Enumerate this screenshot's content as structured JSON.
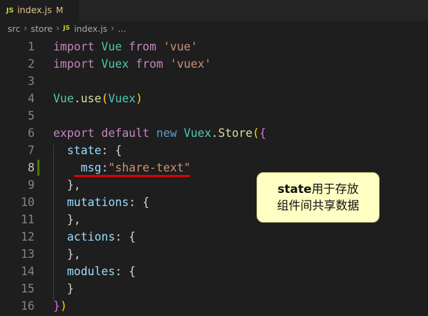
{
  "tab": {
    "icon": "JS",
    "filename": "index.js",
    "status": "M",
    "close_icon": "×"
  },
  "breadcrumb": {
    "parts": [
      "src",
      "store"
    ],
    "file": "index.js",
    "tail": "..."
  },
  "editor": {
    "line_numbers": [
      "1",
      "2",
      "3",
      "4",
      "5",
      "6",
      "7",
      "8",
      "9",
      "10",
      "11",
      "12",
      "13",
      "14",
      "15",
      "16"
    ],
    "active_line": 8,
    "lines": [
      [
        [
          "kw-ctrl",
          "import"
        ],
        [
          "plain",
          " "
        ],
        [
          "cls",
          "Vue"
        ],
        [
          "plain",
          " "
        ],
        [
          "kw-ctrl",
          "from"
        ],
        [
          "plain",
          " "
        ],
        [
          "str",
          "'vue'"
        ]
      ],
      [
        [
          "kw-ctrl",
          "import"
        ],
        [
          "plain",
          " "
        ],
        [
          "cls",
          "Vuex"
        ],
        [
          "plain",
          " "
        ],
        [
          "kw-ctrl",
          "from"
        ],
        [
          "plain",
          " "
        ],
        [
          "str",
          "'vuex'"
        ]
      ],
      [],
      [
        [
          "cls",
          "Vue"
        ],
        [
          "plain",
          "."
        ],
        [
          "fn",
          "use"
        ],
        [
          "b1",
          "("
        ],
        [
          "cls",
          "Vuex"
        ],
        [
          "b1",
          ")"
        ]
      ],
      [],
      [
        [
          "kw-ctrl",
          "export"
        ],
        [
          "plain",
          " "
        ],
        [
          "kw-ctrl",
          "default"
        ],
        [
          "plain",
          " "
        ],
        [
          "kw",
          "new"
        ],
        [
          "plain",
          " "
        ],
        [
          "cls",
          "Vuex"
        ],
        [
          "plain",
          "."
        ],
        [
          "fn",
          "Store"
        ],
        [
          "b1",
          "("
        ],
        [
          "b2",
          "{"
        ]
      ],
      [
        [
          "plain",
          "  "
        ],
        [
          "prop",
          "state"
        ],
        [
          "plain",
          ": {"
        ]
      ],
      [
        [
          "plain",
          "    "
        ],
        [
          "prop",
          "msg"
        ],
        [
          "plain",
          ":"
        ],
        [
          "str",
          "\"share-text\""
        ]
      ],
      [
        [
          "plain",
          "  },"
        ]
      ],
      [
        [
          "plain",
          "  "
        ],
        [
          "prop",
          "mutations"
        ],
        [
          "plain",
          ": {"
        ]
      ],
      [
        [
          "plain",
          "  },"
        ]
      ],
      [
        [
          "plain",
          "  "
        ],
        [
          "prop",
          "actions"
        ],
        [
          "plain",
          ": {"
        ]
      ],
      [
        [
          "plain",
          "  },"
        ]
      ],
      [
        [
          "plain",
          "  "
        ],
        [
          "prop",
          "modules"
        ],
        [
          "plain",
          ": {"
        ]
      ],
      [
        [
          "plain",
          "  }"
        ]
      ],
      [
        [
          "b2",
          "}"
        ],
        [
          "b1",
          ")"
        ]
      ]
    ]
  },
  "callout": {
    "line1_bold": "state",
    "line1_rest": "用于存放",
    "line2": "组件间共享数据"
  }
}
